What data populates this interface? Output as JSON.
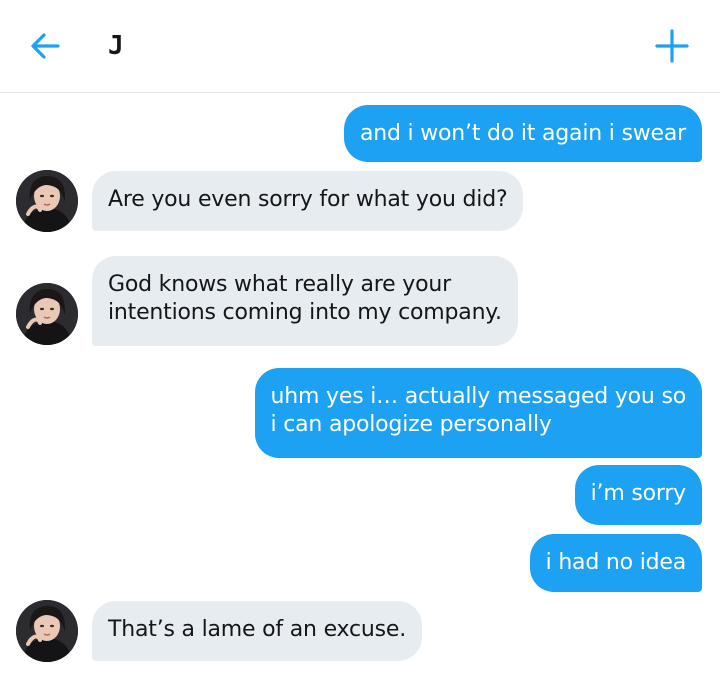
{
  "header": {
    "back_icon": "arrow-left-icon",
    "title": "J",
    "new_icon": "plus-icon",
    "accent_color": "#1da1f2"
  },
  "thread": {
    "messages": [
      {
        "from": "me",
        "text": "and i won’t do it again i swear"
      },
      {
        "from": "them",
        "text": "Are you even sorry for what you did?"
      },
      {
        "from": "them",
        "lines": [
          "God knows what really are your",
          "intentions coming into my company."
        ]
      },
      {
        "from": "me",
        "lines": [
          "uhm yes i… actually messaged you so",
          "i can apologize personally"
        ]
      },
      {
        "from": "me",
        "text": "i’m sorry"
      },
      {
        "from": "me",
        "text": "i had no idea"
      },
      {
        "from": "them",
        "text": "That’s a lame of an excuse."
      }
    ],
    "sent_color": "#1da1f2",
    "received_color": "#e6ecf0"
  }
}
